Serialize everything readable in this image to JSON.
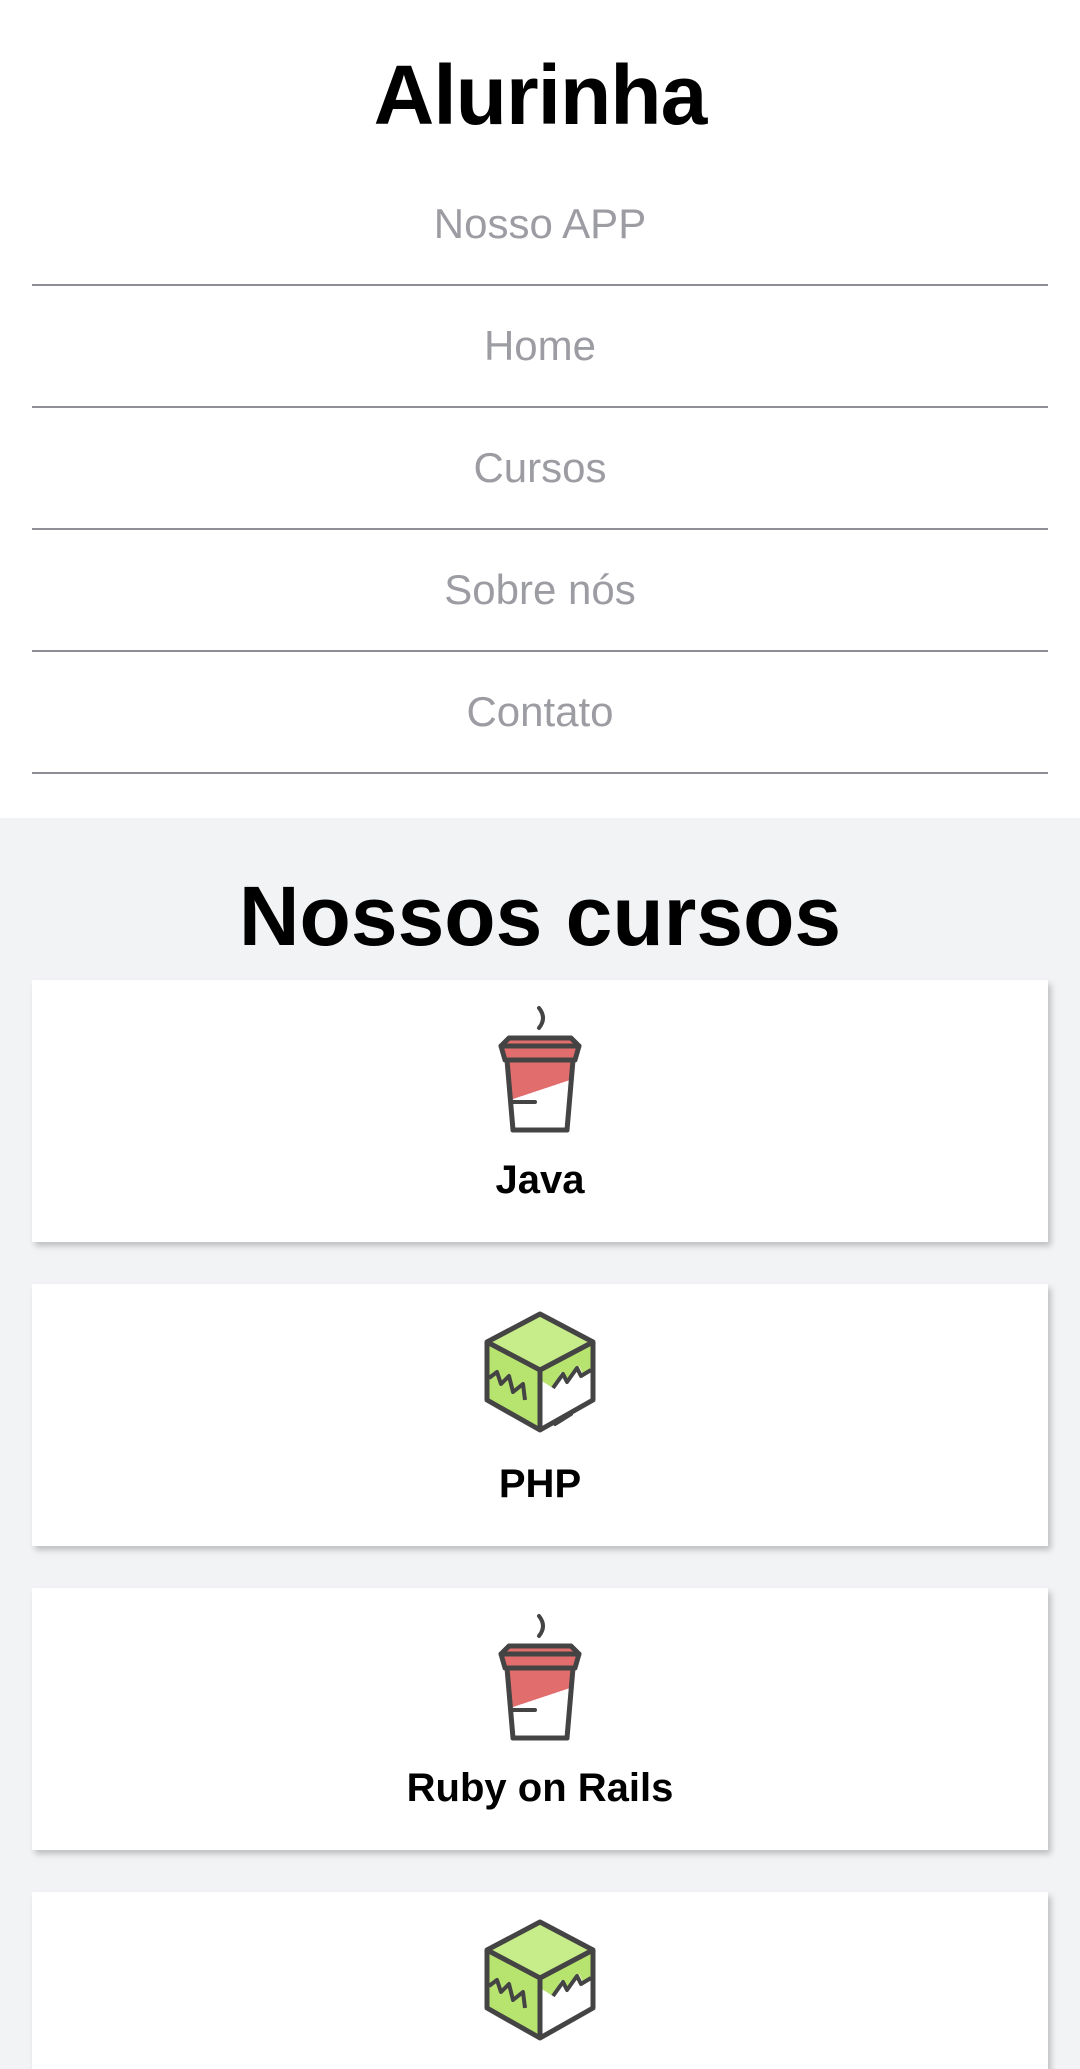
{
  "header": {
    "brand": "Alurinha",
    "nav": [
      {
        "label": "Nosso APP"
      },
      {
        "label": "Home"
      },
      {
        "label": "Cursos"
      },
      {
        "label": "Sobre nós"
      },
      {
        "label": "Contato"
      }
    ]
  },
  "courses": {
    "title": "Nossos cursos",
    "items": [
      {
        "name": "Java",
        "icon": "coffee-cup-icon"
      },
      {
        "name": "PHP",
        "icon": "cube-icon"
      },
      {
        "name": "Ruby on Rails",
        "icon": "coffee-cup-icon"
      },
      {
        "name": "",
        "icon": "cube-icon"
      }
    ]
  },
  "colors": {
    "nav_text": "#9c9ca3",
    "section_bg": "#f2f3f5",
    "cup_red": "#e26d6d",
    "cube_green": "#b7e36f",
    "icon_outline": "#444444"
  }
}
